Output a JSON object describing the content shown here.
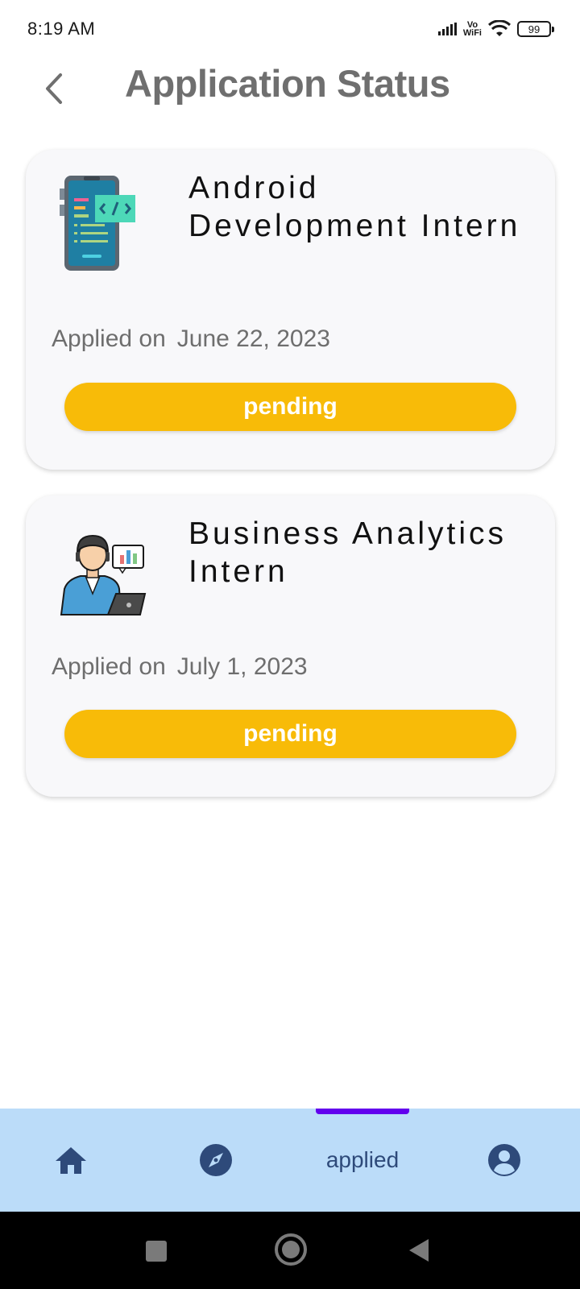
{
  "status_bar": {
    "time": "8:19 AM",
    "vowifi_top": "Vo",
    "vowifi_bottom": "WiFi",
    "battery": "99"
  },
  "header": {
    "title": "Application Status",
    "back_icon": "chevron-left-icon"
  },
  "applications": [
    {
      "title": "Android Development Intern",
      "applied_label": "Applied on",
      "applied_date": "June 22, 2023",
      "status": "pending",
      "icon": "mobile-code-icon"
    },
    {
      "title": "Business Analytics Intern",
      "applied_label": "Applied on",
      "applied_date": "July 1, 2023",
      "status": "pending",
      "icon": "analyst-person-icon"
    }
  ],
  "bottom_nav": {
    "items": [
      {
        "icon": "home-icon"
      },
      {
        "icon": "compass-icon"
      },
      {
        "label": "applied"
      },
      {
        "icon": "account-icon"
      }
    ],
    "active_index": 2
  },
  "colors": {
    "status_pending": "#f8bb08",
    "nav_background": "#bbdcf9",
    "nav_indicator": "#6200ee",
    "nav_icon": "#2e4a7a",
    "title_gray": "#6f6f6f"
  }
}
